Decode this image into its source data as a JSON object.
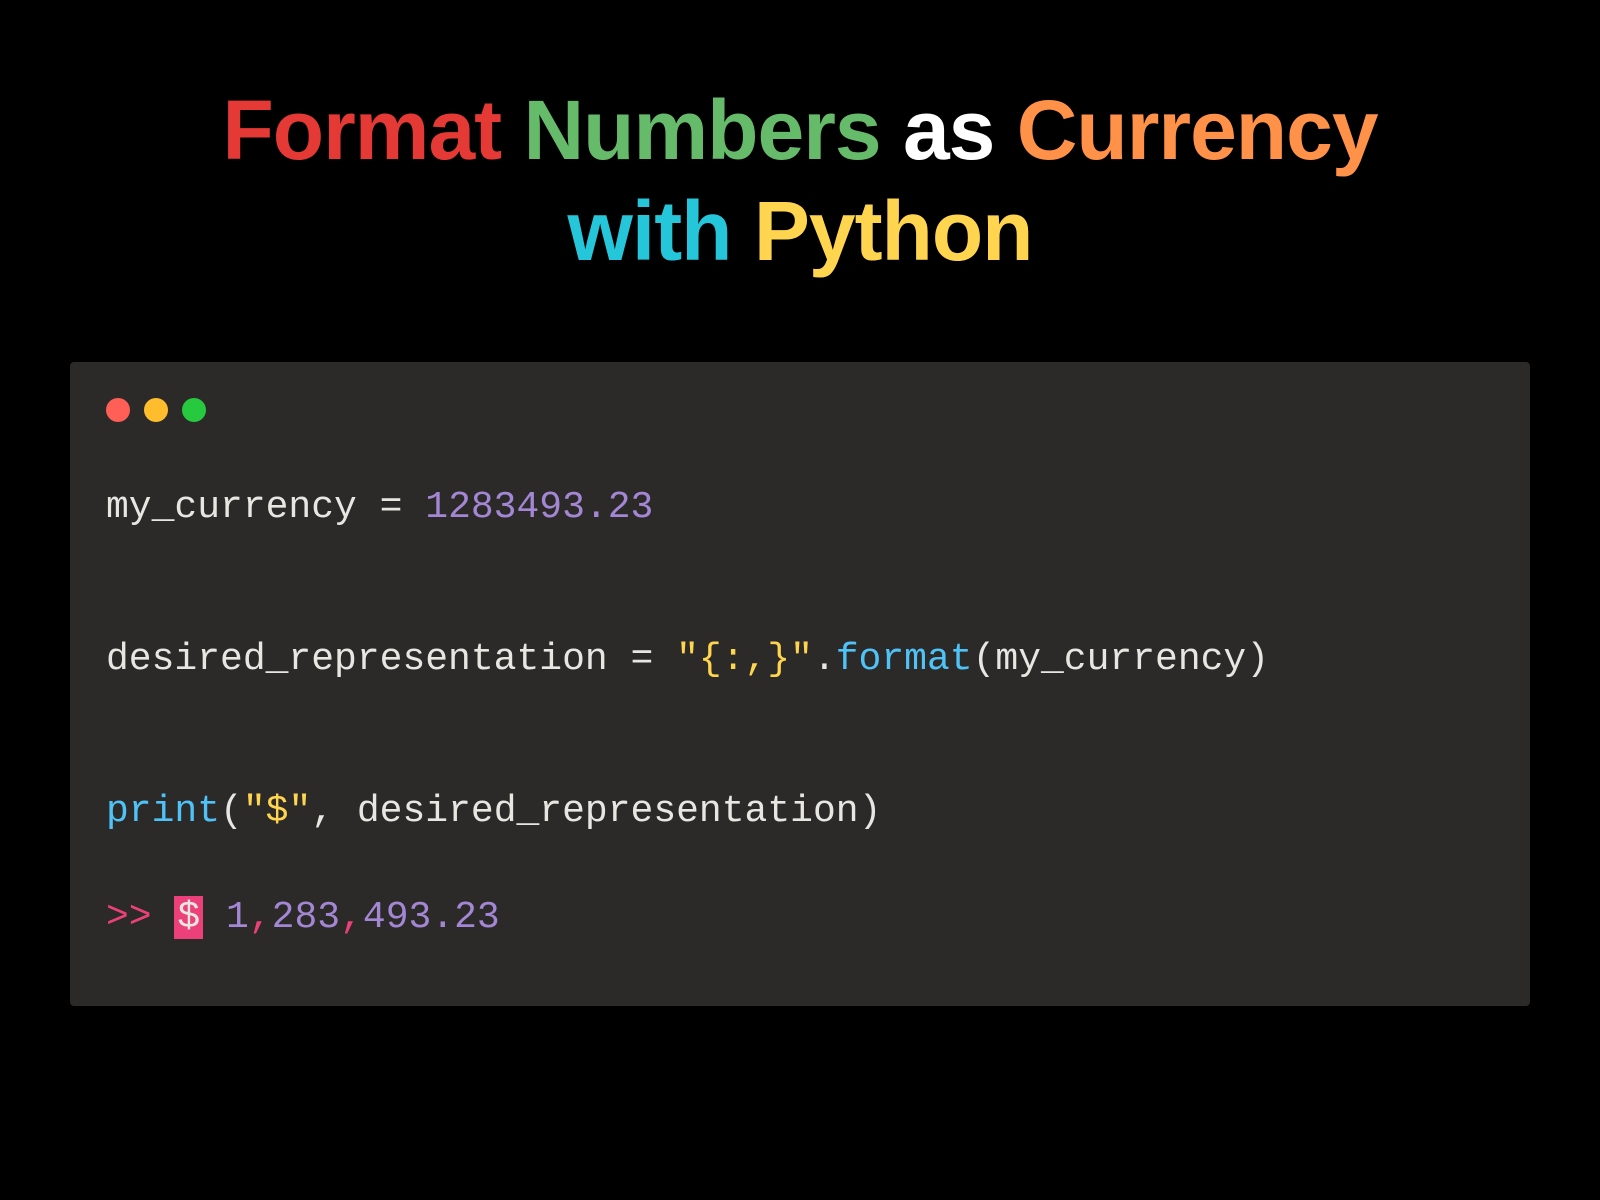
{
  "title": {
    "word1": "Format",
    "word2": "Numbers",
    "word3": "as",
    "word4": "Currency",
    "word5": "with",
    "word6": "Python"
  },
  "code": {
    "line1": {
      "var": "my_currency",
      "op": " = ",
      "val": "1283493.23"
    },
    "line2": {
      "var": "desired_representation",
      "op": " = ",
      "str": "\"{:,}\"",
      "dot": ".",
      "method": "format",
      "open": "(",
      "arg": "my_currency",
      "close": ")"
    },
    "line3": {
      "fn": "print",
      "open": "(",
      "str": "\"$\"",
      "comma": ", ",
      "arg": "desired_representation",
      "close": ")"
    }
  },
  "output": {
    "prompt": ">>",
    "dollar": "$",
    "space": " ",
    "p1": "1",
    "c1": ",",
    "p2": "283",
    "c2": ",",
    "p3": "493.23"
  }
}
